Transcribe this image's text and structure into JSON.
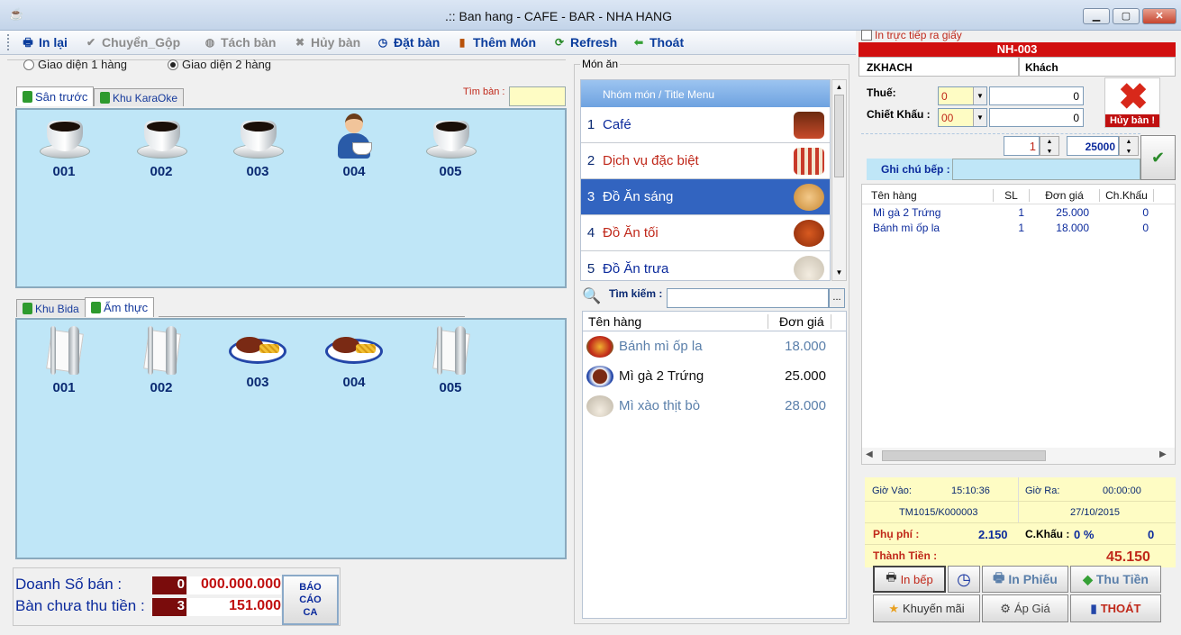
{
  "window": {
    "title": ".:: Ban hang - CAFE - BAR - NHA HANG",
    "min": "▁",
    "max": "▢",
    "close": "✕"
  },
  "toolbar": {
    "print_again": "In lại",
    "transfer": "Chuyển_Gộp",
    "split": "Tách bàn",
    "cancel_table": "Hủy bàn",
    "reserve": "Đặt bàn",
    "add_dish": "Thêm Món",
    "refresh": "Refresh",
    "exit": "Thoát"
  },
  "layout_options": {
    "one_row": "Giao diện 1 hàng",
    "two_rows": "Giao diện 2 hàng",
    "selected": "two_rows"
  },
  "search_table": {
    "label": "Tìm bàn :",
    "value": ""
  },
  "area_top": {
    "tabs": [
      "Sân trước",
      "Khu KaraOke"
    ],
    "active": 0,
    "tables": [
      {
        "label": "001",
        "icon": "coffee-cup"
      },
      {
        "label": "002",
        "icon": "coffee-cup"
      },
      {
        "label": "003",
        "icon": "coffee-cup"
      },
      {
        "label": "004",
        "icon": "customer-with-coffee"
      },
      {
        "label": "005",
        "icon": "coffee-cup"
      }
    ]
  },
  "area_bottom": {
    "tabs": [
      "Khu Bida",
      "Ẩm thực"
    ],
    "active": 1,
    "tables": [
      {
        "label": "001",
        "icon": "cutlery"
      },
      {
        "label": "002",
        "icon": "cutlery"
      },
      {
        "label": "003",
        "icon": "steak-plate"
      },
      {
        "label": "004",
        "icon": "steak-plate"
      },
      {
        "label": "005",
        "icon": "cutlery"
      }
    ]
  },
  "summary": {
    "sales_label": "Doanh Số bán :",
    "sales_count": "0",
    "sales_value": "000.000.000",
    "unpaid_label": "Bàn chưa thu tiền :",
    "unpaid_count": "3",
    "unpaid_value": "151.000",
    "report_button": "BÁO CÁO CA"
  },
  "menu": {
    "group_label": "Món ăn",
    "header": "Nhóm món / Title Menu",
    "items": [
      {
        "n": "1",
        "name": "Café",
        "color": "#0b2a9c",
        "icon": "iced-drink"
      },
      {
        "n": "2",
        "name": "Dịch vụ đặc biệt",
        "color": "#c0281a",
        "icon": "shop"
      },
      {
        "n": "3",
        "name": "Đồ Ăn sáng",
        "color": "#ffffff",
        "icon": "bread"
      },
      {
        "n": "4",
        "name": "Đồ Ăn tối",
        "color": "#c0281a",
        "icon": "roast-chicken"
      },
      {
        "n": "5",
        "name": "Đồ Ăn trưa",
        "color": "#0b2a9c",
        "icon": "noodle-bowl"
      }
    ],
    "selected": 2
  },
  "product_search": {
    "label": "Tìm kiếm :",
    "value": "",
    "more": "..."
  },
  "products": {
    "headers": [
      "Tên hàng",
      "Đơn giá"
    ],
    "rows": [
      {
        "name": "Bánh mì ốp la",
        "price": "18.000",
        "color": "#5a7faa"
      },
      {
        "name": "Mì gà 2 Trứng",
        "price": "25.000",
        "color": "#111111"
      },
      {
        "name": "Mì xào thịt bò",
        "price": "28.000",
        "color": "#5a7faa"
      }
    ]
  },
  "order": {
    "print_direct": "In trực tiếp ra giấy",
    "table_code": "NH-003",
    "customer_code": "ZKHACH",
    "customer_name": "Khách",
    "tax_label": "Thuế:",
    "tax_code": "0",
    "tax_value": "0",
    "discount_label": "Chiết Khấu :",
    "discount_code": "00",
    "discount_value": "0",
    "cancel_table": "Hủy bàn !",
    "qty": "1",
    "price": "25000",
    "kitchen_note_label": "Ghi chú bếp :",
    "kitchen_note": "",
    "headers": [
      "Tên hàng",
      "SL",
      "Đơn giá",
      "Ch.Khấu"
    ],
    "lines": [
      {
        "name": "Mì gà 2 Trứng",
        "qty": "1",
        "price": "25.000",
        "disc": "0"
      },
      {
        "name": "Bánh mì ốp la",
        "qty": "1",
        "price": "18.000",
        "disc": "0"
      }
    ],
    "time_in_label": "Giờ Vào:",
    "time_in": "15:10:36",
    "time_out_label": "Giờ Ra:",
    "time_out": "00:00:00",
    "invoice": "TM1015/K000003",
    "date": "27/10/2015",
    "surcharge_label": "Phụ phí :",
    "surcharge": "2.150",
    "disc2_label": "C.Khấu :",
    "disc2_pct": "0 %",
    "disc2_value": "0",
    "total_label": "Thành Tiền :",
    "total": "45.150"
  },
  "actions": {
    "print_kitchen": "In bếp",
    "print_bill": "In Phiếu",
    "collect": "Thu Tiền",
    "promo": "Khuyến mãi",
    "apply_price": "Áp Giá",
    "exit": "THOÁT"
  },
  "colors": {
    "accent": "#0a3c9c",
    "panel": "#bfe6f7",
    "danger": "#d10f0f",
    "selected": "#3264c0"
  }
}
